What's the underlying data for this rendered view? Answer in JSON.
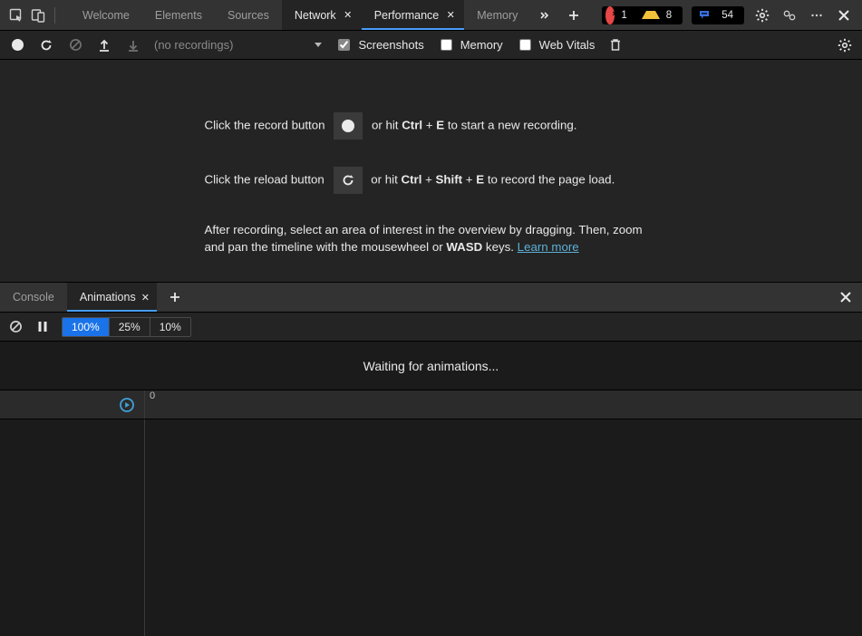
{
  "topTabs": {
    "welcome": "Welcome",
    "elements": "Elements",
    "sources": "Sources",
    "network": "Network",
    "performance": "Performance",
    "memory": "Memory"
  },
  "badges": {
    "errors": "1",
    "warnings": "8",
    "messages": "54"
  },
  "toolbar": {
    "no_recordings": "(no recordings)",
    "screenshots": "Screenshots",
    "memory": "Memory",
    "web_vitals": "Web Vitals"
  },
  "instructions": {
    "l1a": "Click the record button ",
    "l1b": " or hit ",
    "l1c": "Ctrl",
    "l1d": " + ",
    "l1e": "E",
    "l1f": " to start a new recording.",
    "l2a": "Click the reload button ",
    "l2b": " or hit ",
    "l2c": "Ctrl",
    "l2d": " + ",
    "l2e": "Shift",
    "l2f": " + ",
    "l2g": "E",
    "l2h": " to record the page load.",
    "l3a": "After recording, select an area of interest in the overview by dragging. Then, zoom and pan the timeline with the mousewheel or ",
    "l3b": "WASD",
    "l3c": " keys. ",
    "learn_more": "Learn more"
  },
  "drawer": {
    "console": "Console",
    "animations": "Animations"
  },
  "anim": {
    "speed100": "100%",
    "speed25": "25%",
    "speed10": "10%",
    "waiting": "Waiting for animations...",
    "zero": "0"
  }
}
